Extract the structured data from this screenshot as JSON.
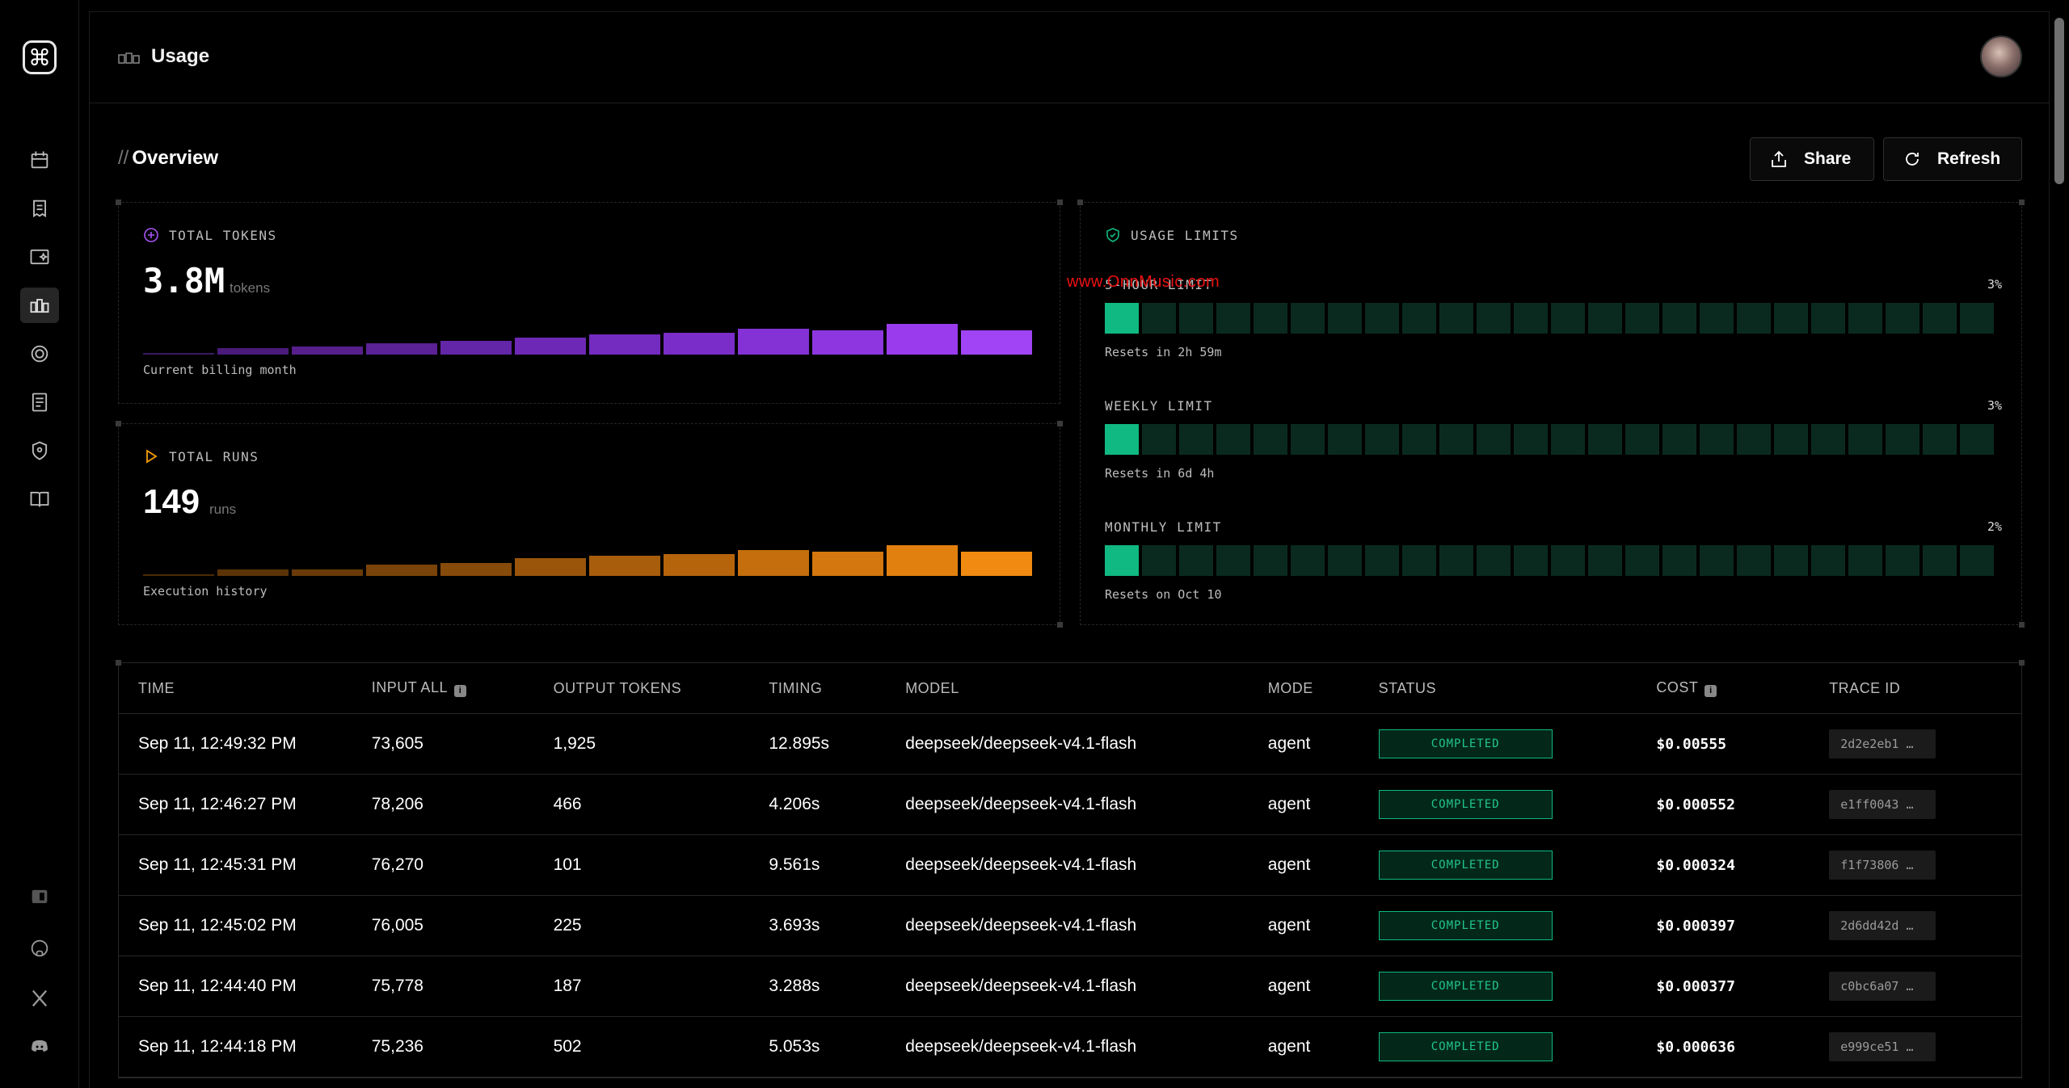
{
  "header": {
    "title": "Usage"
  },
  "overview": {
    "title": "Overview",
    "slash": "//",
    "share_label": "Share",
    "refresh_label": "Refresh"
  },
  "tokens_card": {
    "label": "TOTAL TOKENS",
    "value": "3.8M",
    "unit": "tokens",
    "caption": "Current billing month",
    "bar_levels": [
      0.05,
      0.2,
      0.25,
      0.38,
      0.45,
      0.55,
      0.65,
      0.72,
      0.85,
      0.78,
      1.0,
      0.8
    ],
    "bar_colors": [
      "#3b1763",
      "#4a1b7a",
      "#561f8c",
      "#5b2196",
      "#6426a8",
      "#6d29b6",
      "#742bc0",
      "#7a2dc8",
      "#8431d6",
      "#8e36e0",
      "#9a3cee",
      "#a044f5"
    ]
  },
  "runs_card": {
    "label": "TOTAL RUNS",
    "value": "149",
    "unit": "runs",
    "caption": "Execution history",
    "bar_levels": [
      0.05,
      0.2,
      0.22,
      0.38,
      0.42,
      0.58,
      0.65,
      0.72,
      0.85,
      0.78,
      1.0,
      0.8
    ],
    "bar_colors": [
      "#4a2a05",
      "#5b3307",
      "#6a3b08",
      "#7a4309",
      "#864a0a",
      "#9a550b",
      "#a85d0c",
      "#b5640c",
      "#c46e0d",
      "#d3770e",
      "#e2800f",
      "#f08a10"
    ]
  },
  "usage_limits": {
    "label": "USAGE LIMITS",
    "limits": [
      {
        "name": "5-HOUR LIMIT",
        "percent_text": "3%",
        "reset": "Resets in 2h 59m",
        "filled_segments": 1,
        "total_segments": 24
      },
      {
        "name": "WEEKLY LIMIT",
        "percent_text": "3%",
        "reset": "Resets in 6d 4h",
        "filled_segments": 1,
        "total_segments": 24
      },
      {
        "name": "MONTHLY LIMIT",
        "percent_text": "2%",
        "reset": "Resets on Oct 10",
        "filled_segments": 1,
        "total_segments": 24
      }
    ]
  },
  "watermark": "www.OnnMusic.com",
  "table": {
    "headers": [
      "TIME",
      "INPUT ALL",
      "OUTPUT TOKENS",
      "TIMING",
      "MODEL",
      "MODE",
      "STATUS",
      "COST",
      "TRACE ID"
    ],
    "rows": [
      {
        "time": "Sep 11, 12:49:32 PM",
        "input": "73,605",
        "output": "1,925",
        "timing": "12.895s",
        "model": "deepseek/deepseek-v4.1-flash",
        "mode": "agent",
        "status": "COMPLETED",
        "cost": "$0.00555",
        "trace": "2d2e2eb1 …"
      },
      {
        "time": "Sep 11, 12:46:27 PM",
        "input": "78,206",
        "output": "466",
        "timing": "4.206s",
        "model": "deepseek/deepseek-v4.1-flash",
        "mode": "agent",
        "status": "COMPLETED",
        "cost": "$0.000552",
        "trace": "e1ff0043 …"
      },
      {
        "time": "Sep 11, 12:45:31 PM",
        "input": "76,270",
        "output": "101",
        "timing": "9.561s",
        "model": "deepseek/deepseek-v4.1-flash",
        "mode": "agent",
        "status": "COMPLETED",
        "cost": "$0.000324",
        "trace": "f1f73806 …"
      },
      {
        "time": "Sep 11, 12:45:02 PM",
        "input": "76,005",
        "output": "225",
        "timing": "3.693s",
        "model": "deepseek/deepseek-v4.1-flash",
        "mode": "agent",
        "status": "COMPLETED",
        "cost": "$0.000397",
        "trace": "2d6dd42d …"
      },
      {
        "time": "Sep 11, 12:44:40 PM",
        "input": "75,778",
        "output": "187",
        "timing": "3.288s",
        "model": "deepseek/deepseek-v4.1-flash",
        "mode": "agent",
        "status": "COMPLETED",
        "cost": "$0.000377",
        "trace": "c0bc6a07 …"
      },
      {
        "time": "Sep 11, 12:44:18 PM",
        "input": "75,236",
        "output": "502",
        "timing": "5.053s",
        "model": "deepseek/deepseek-v4.1-flash",
        "mode": "agent",
        "status": "COMPLETED",
        "cost": "$0.000636",
        "trace": "e999ce51 …"
      }
    ]
  },
  "colors": {
    "accent_green": "#10b981",
    "purple": "#9a3cee",
    "orange": "#f08a10"
  }
}
